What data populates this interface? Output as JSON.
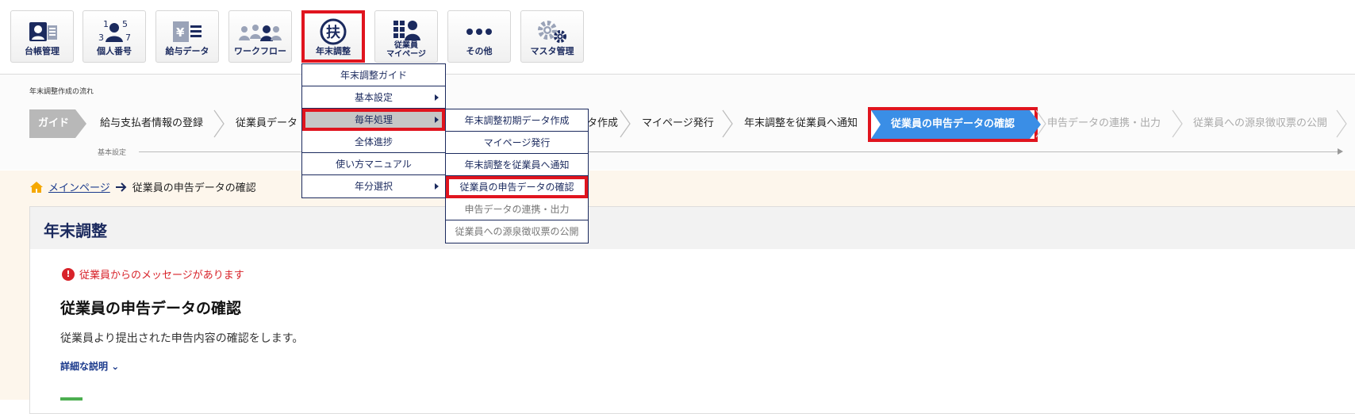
{
  "nav": {
    "items": [
      {
        "label": "台帳管理",
        "icon": "ledger-icon"
      },
      {
        "label": "個人番号",
        "icon": "personal-number-icon"
      },
      {
        "label": "給与データ",
        "icon": "salary-data-icon"
      },
      {
        "label": "ワークフロー",
        "icon": "workflow-icon"
      },
      {
        "label": "年末調整",
        "icon": "year-end-adjustment-icon",
        "glyph": "扶"
      },
      {
        "label": "従業員\nマイページ",
        "icon": "employee-mypage-icon"
      },
      {
        "label": "その他",
        "icon": "more-icon"
      },
      {
        "label": "マスタ管理",
        "icon": "master-settings-icon"
      }
    ]
  },
  "flow": {
    "title": "年末調整作成の流れ",
    "guide_label": "ガイド",
    "steps": [
      "給与支払者情報の登録",
      "従業員データ",
      "タ作成",
      "マイページ発行",
      "年末調整を従業員へ通知",
      "従業員の申告データの確認",
      "申告データの連携・出力",
      "従業員への源泉徴収票の公開"
    ],
    "basic_settings_label": "基本設定"
  },
  "menu": {
    "items": [
      {
        "label": "年末調整ガイド",
        "submenu": false
      },
      {
        "label": "基本設定",
        "submenu": true
      },
      {
        "label": "毎年処理",
        "submenu": true
      },
      {
        "label": "全体進捗",
        "submenu": false
      },
      {
        "label": "使い方マニュアル",
        "submenu": false
      },
      {
        "label": "年分選択",
        "submenu": true
      }
    ]
  },
  "submenu": {
    "items": [
      "年末調整初期データ作成",
      "マイページ発行",
      "年末調整を従業員へ通知",
      "従業員の申告データの確認",
      "申告データの連携・出力",
      "従業員への源泉徴収票の公開"
    ]
  },
  "breadcrumb": {
    "home_label": "メインページ",
    "current": "従業員の申告データの確認"
  },
  "panel": {
    "title": "年末調整",
    "message": "従業員からのメッセージがあります",
    "heading": "従業員の申告データの確認",
    "description": "従業員より提出された申告内容の確認をします。",
    "details_link": "詳細な説明"
  },
  "colors": {
    "navy": "#1b2a5e",
    "highlight_red": "#e0141e",
    "active_step_blue": "#3a8ee6",
    "error_red": "#d8232a"
  }
}
